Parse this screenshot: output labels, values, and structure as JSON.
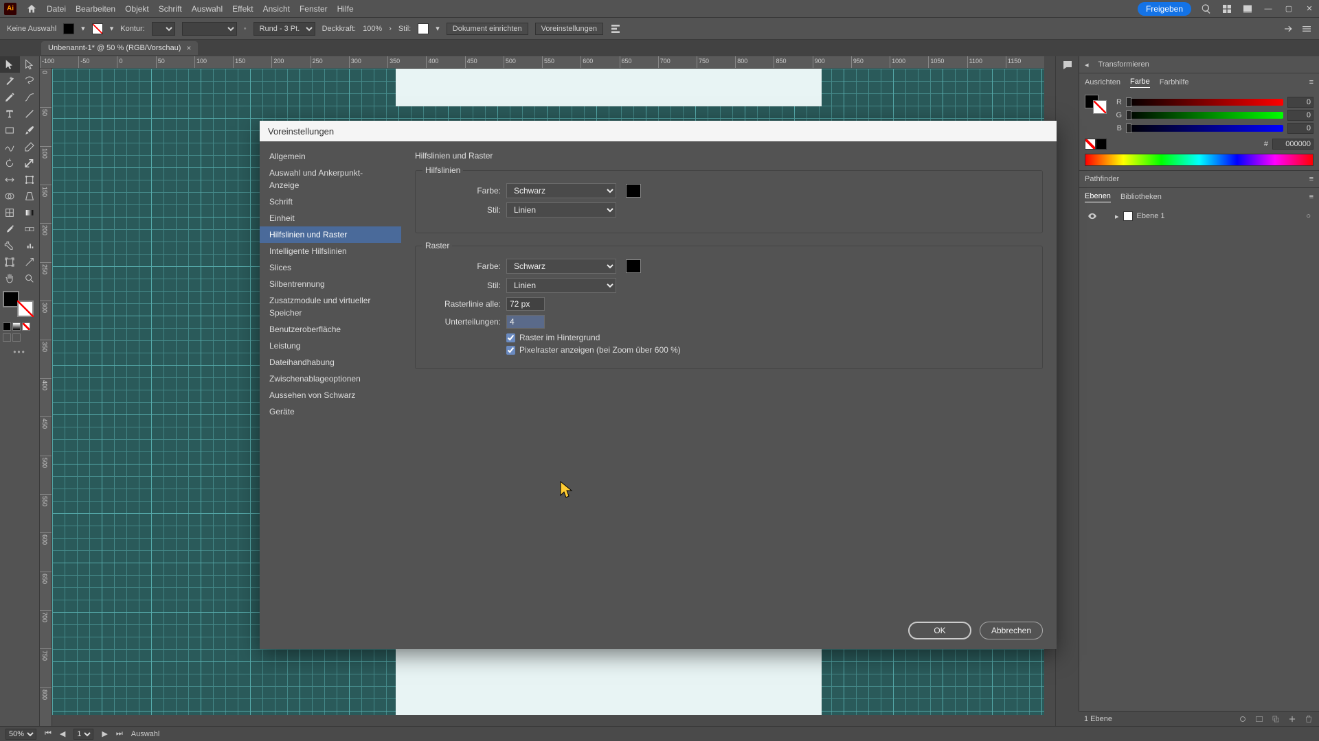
{
  "menu": {
    "items": [
      "Datei",
      "Bearbeiten",
      "Objekt",
      "Schrift",
      "Auswahl",
      "Effekt",
      "Ansicht",
      "Fenster",
      "Hilfe"
    ],
    "share": "Freigeben"
  },
  "control": {
    "no_selection": "Keine Auswahl",
    "contour": "Kontur:",
    "stroke_preset": "Rund - 3 Pt.",
    "opacity_label": "Deckkraft:",
    "opacity_value": "100%",
    "style_label": "Stil:",
    "btn_docsetup": "Dokument einrichten",
    "btn_prefs": "Voreinstellungen"
  },
  "doctab": {
    "title": "Unbenannt-1* @ 50 % (RGB/Vorschau)"
  },
  "ruler_h": [
    "-100",
    "-50",
    "0",
    "50",
    "100",
    "150",
    "200",
    "250",
    "300",
    "350",
    "400",
    "450",
    "500",
    "550",
    "600",
    "650",
    "700",
    "750",
    "800",
    "850",
    "900",
    "950",
    "1000",
    "1050",
    "1100",
    "1150"
  ],
  "ruler_v": [
    "0",
    "50",
    "100",
    "150",
    "200",
    "250",
    "300",
    "350",
    "400",
    "450",
    "500",
    "550",
    "600",
    "650",
    "700",
    "750",
    "800"
  ],
  "rpanel": {
    "transform_tab": "Transformieren",
    "align_tab": "Ausrichten",
    "color_tab": "Farbe",
    "colorguide_tab": "Farbhilfe",
    "r": "R",
    "g": "G",
    "b": "B",
    "r_val": "0",
    "g_val": "0",
    "b_val": "0",
    "hash": "#",
    "hex": "000000",
    "pathfinder_tab": "Pathfinder",
    "layers_tab": "Ebenen",
    "libs_tab": "Bibliotheken",
    "layer1": "Ebene 1",
    "layer_count": "1 Ebene"
  },
  "status": {
    "zoom": "50%",
    "page": "1",
    "tool": "Auswahl"
  },
  "dialog": {
    "title": "Voreinstellungen",
    "sidebar": [
      "Allgemein",
      "Auswahl und Ankerpunkt-Anzeige",
      "Schrift",
      "Einheit",
      "Hilfslinien und Raster",
      "Intelligente Hilfslinien",
      "Slices",
      "Silbentrennung",
      "Zusatzmodule und virtueller Speicher",
      "Benutzeroberfläche",
      "Leistung",
      "Dateihandhabung",
      "Zwischenablageoptionen",
      "Aussehen von Schwarz",
      "Geräte"
    ],
    "selected_index": 4,
    "heading": "Hilfslinien und Raster",
    "guides": {
      "legend": "Hilfslinien",
      "color_label": "Farbe:",
      "color_value": "Schwarz",
      "style_label": "Stil:",
      "style_value": "Linien"
    },
    "grid": {
      "legend": "Raster",
      "color_label": "Farbe:",
      "color_value": "Schwarz",
      "style_label": "Stil:",
      "style_value": "Linien",
      "every_label": "Rasterlinie alle:",
      "every_value": "72 px",
      "subdiv_label": "Unterteilungen:",
      "subdiv_value": "4",
      "chk_back": "Raster im Hintergrund",
      "chk_pixel": "Pixelraster anzeigen (bei Zoom über 600 %)"
    },
    "ok": "OK",
    "cancel": "Abbrechen"
  }
}
